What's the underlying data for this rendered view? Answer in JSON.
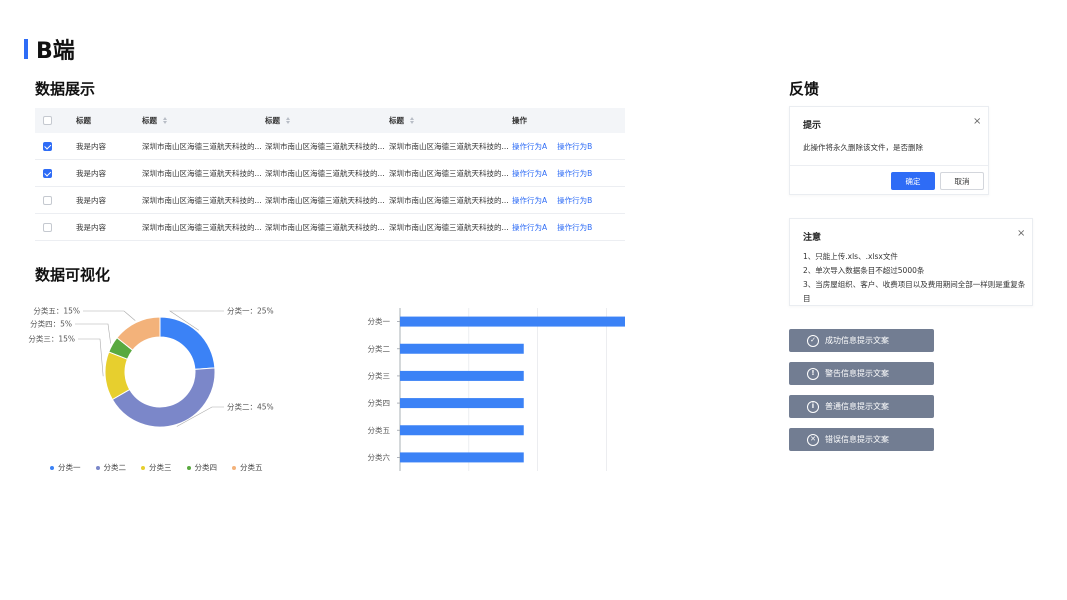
{
  "page": {
    "title": "B端"
  },
  "sections": {
    "data_display": "数据展示",
    "visualization": "数据可视化",
    "feedback": "反馈"
  },
  "table": {
    "headers": [
      "标题",
      "标题",
      "标题",
      "标题",
      "操作"
    ],
    "rows": [
      {
        "checked": true,
        "cells": [
          "我是内容",
          "深圳市南山区海德三道航天科技的...",
          "深圳市南山区海德三道航天科技的...",
          "深圳市南山区海德三道航天科技的..."
        ],
        "actions": [
          "操作行为A",
          "操作行为B"
        ]
      },
      {
        "checked": true,
        "cells": [
          "我是内容",
          "深圳市南山区海德三道航天科技的...",
          "深圳市南山区海德三道航天科技的...",
          "深圳市南山区海德三道航天科技的..."
        ],
        "actions": [
          "操作行为A",
          "操作行为B"
        ]
      },
      {
        "checked": false,
        "cells": [
          "我是内容",
          "深圳市南山区海德三道航天科技的...",
          "深圳市南山区海德三道航天科技的...",
          "深圳市南山区海德三道航天科技的..."
        ],
        "actions": [
          "操作行为A",
          "操作行为B"
        ]
      },
      {
        "checked": false,
        "cells": [
          "我是内容",
          "深圳市南山区海德三道航天科技的...",
          "深圳市南山区海德三道航天科技的...",
          "深圳市南山区海德三道航天科技的..."
        ],
        "actions": [
          "操作行为A",
          "操作行为B"
        ]
      }
    ]
  },
  "chart_data": [
    {
      "type": "pie",
      "categories": [
        "分类一",
        "分类二",
        "分类三",
        "分类四",
        "分类五"
      ],
      "values": [
        25,
        45,
        15,
        5,
        15
      ],
      "labels": [
        "分类一：25%",
        "分类二：45%",
        "分类三：15%",
        "分类四：5%",
        "分类五：15%"
      ],
      "colors": [
        "#3b82f6",
        "#7b87c9",
        "#e7cf2e",
        "#59a93f",
        "#f3b27a"
      ],
      "legend": "bottom"
    },
    {
      "type": "bar",
      "orientation": "horizontal",
      "categories": [
        "分类一",
        "分类二",
        "分类三",
        "分类四",
        "分类五",
        "分类六"
      ],
      "values": [
        100,
        55,
        55,
        55,
        55,
        55
      ],
      "xlim": [
        0,
        100
      ],
      "grid": true,
      "color": "#3b82f6"
    }
  ],
  "dialog_confirm": {
    "title": "提示",
    "message": "此操作将永久删除该文件，是否删除",
    "ok_label": "确定",
    "cancel_label": "取消",
    "close_glyph": "×"
  },
  "dialog_notice": {
    "title": "注意",
    "lines": [
      "1、只能上传.xls、.xlsx文件",
      "2、单次导入数据条目不超过5000条",
      "3、当房屋组织、客户、收费项目以及费用期间全部一样则是重复条目"
    ],
    "close_glyph": "×"
  },
  "toasts": [
    {
      "icon": "check-circle-icon",
      "glyph": "✓",
      "label": "成功信息提示文案"
    },
    {
      "icon": "warning-circle-icon",
      "glyph": "!",
      "label": "警告信息提示文案"
    },
    {
      "icon": "info-circle-icon",
      "glyph": "i",
      "label": "普通信息提示文案"
    },
    {
      "icon": "error-circle-icon",
      "glyph": "✕",
      "label": "错误信息提示文案"
    }
  ]
}
